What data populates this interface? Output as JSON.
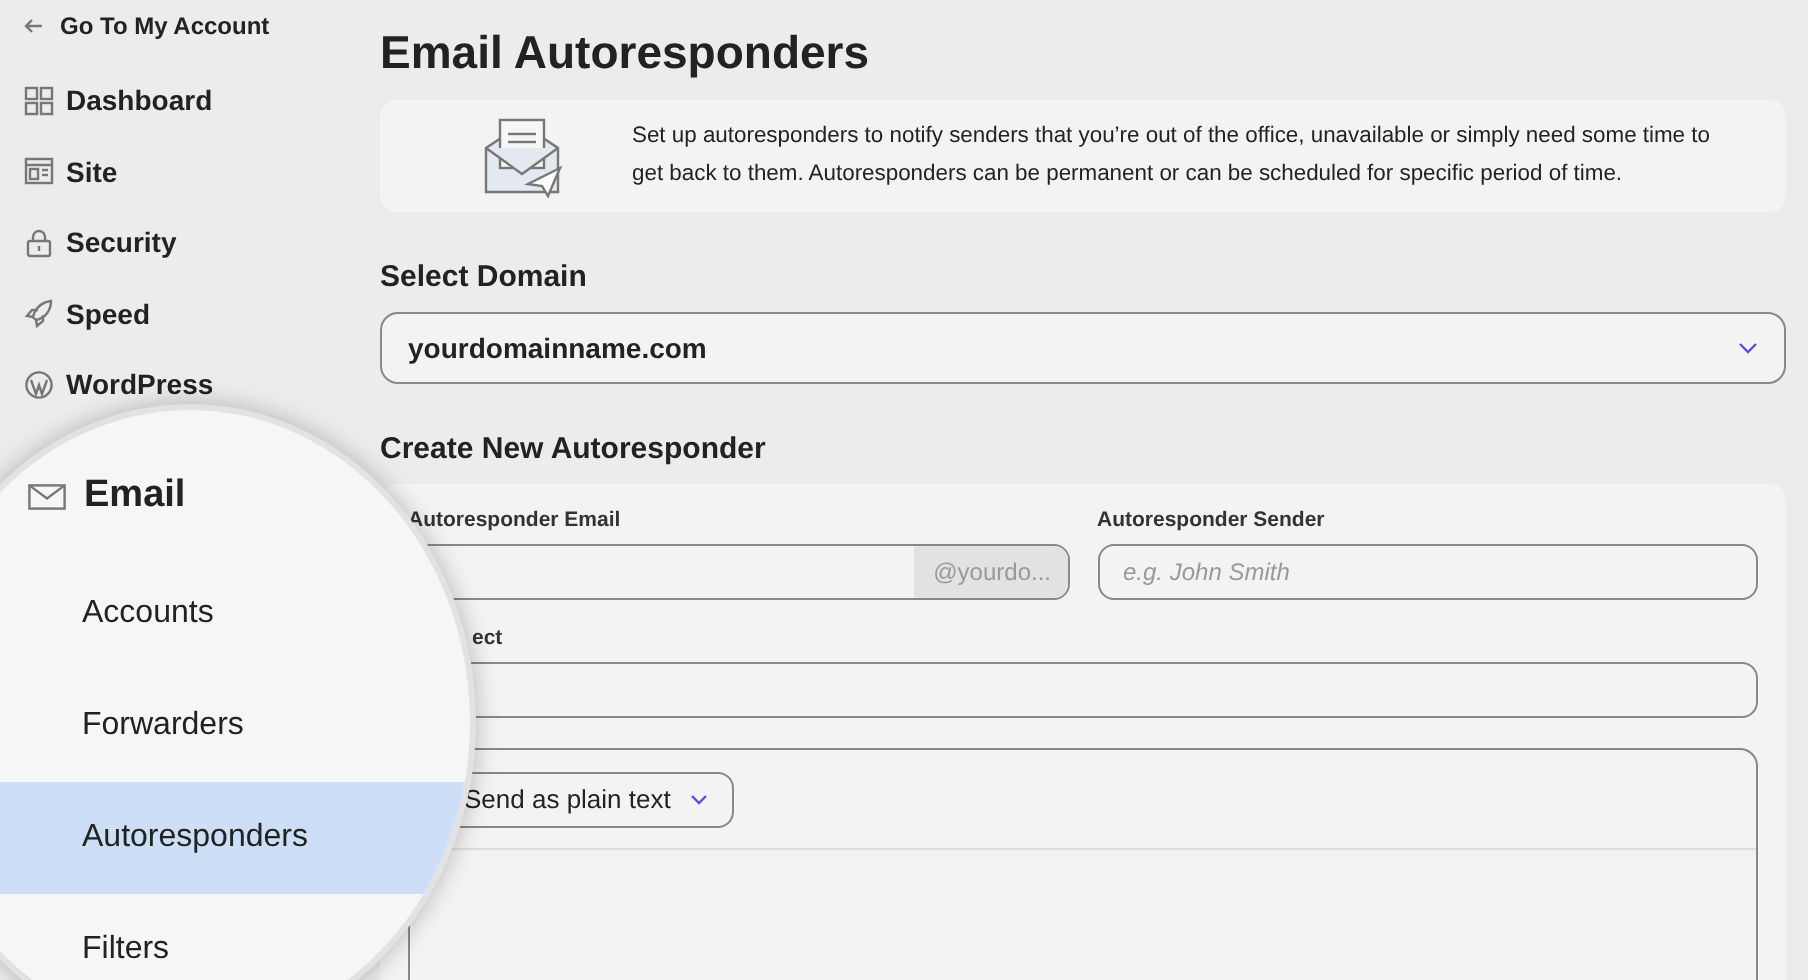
{
  "sidebar": {
    "back_link": "Go To My Account",
    "items": [
      {
        "label": "Dashboard"
      },
      {
        "label": "Site"
      },
      {
        "label": "Security"
      },
      {
        "label": "Speed"
      },
      {
        "label": "WordPress"
      }
    ]
  },
  "magnifier": {
    "section": "Email",
    "items": [
      {
        "label": "Accounts",
        "selected": false
      },
      {
        "label": "Forwarders",
        "selected": false
      },
      {
        "label": "Autoresponders",
        "selected": true
      },
      {
        "label": "Filters",
        "selected": false
      }
    ]
  },
  "page": {
    "title": "Email Autoresponders",
    "intro": "Set up autoresponders to notify senders that you’re out of the office, unavailable or simply need some time to get back to them. Autoresponders can be permanent or can be scheduled for specific period of time.",
    "domain_label": "Select Domain",
    "domain_value": "yourdomainname.com",
    "create_heading": "Create New Autoresponder",
    "email_label": "Autoresponder Email",
    "email_suffix": "@yourdo...",
    "sender_label": "Autoresponder Sender",
    "sender_placeholder": "e.g. John Smith",
    "subject_label": "ect",
    "format_button": "Send as plain text"
  }
}
